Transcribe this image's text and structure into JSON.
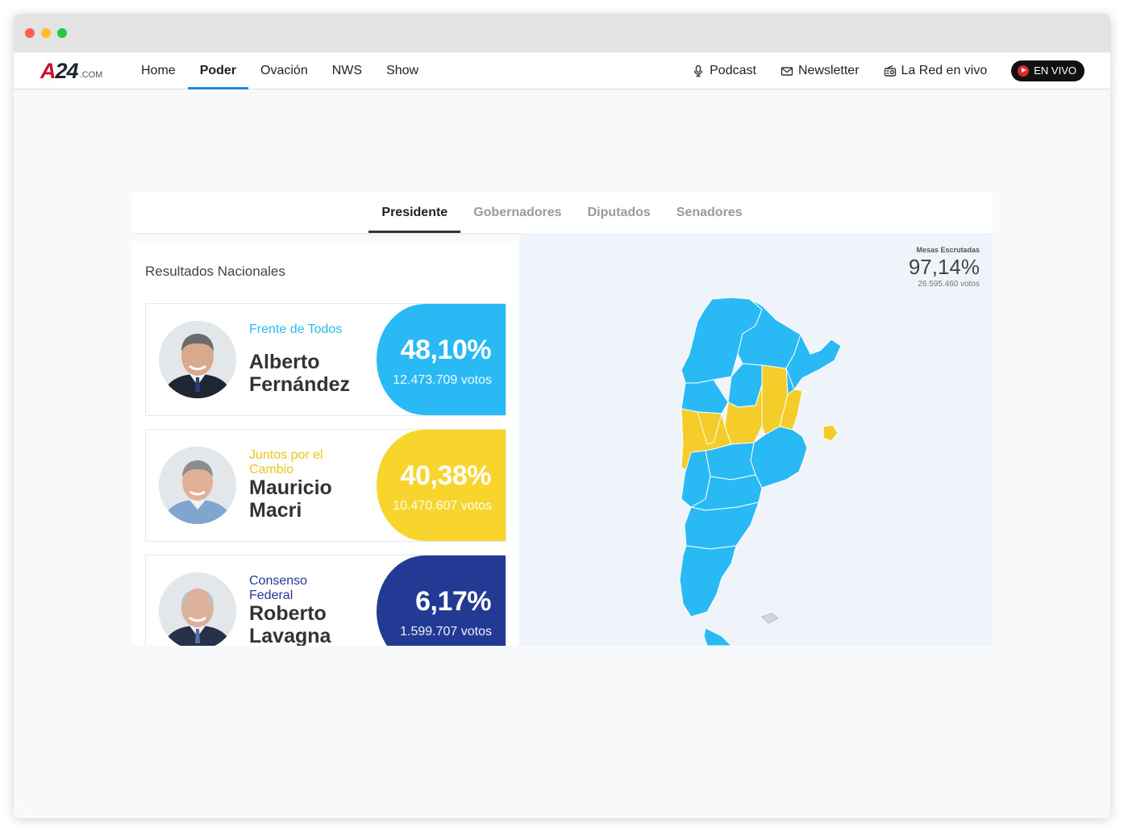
{
  "browser": {
    "dots": [
      "#ff5f57",
      "#febc2e",
      "#28c840"
    ]
  },
  "nav": {
    "logo_main": "A24",
    "logo_suffix": ".COM",
    "links": [
      "Home",
      "Poder",
      "Ovación",
      "NWS",
      "Show"
    ],
    "active_link": "Poder",
    "right_items": [
      {
        "label": "Podcast",
        "icon": "microphone-icon"
      },
      {
        "label": "Newsletter",
        "icon": "envelope-icon"
      },
      {
        "label": "La Red en vivo",
        "icon": "radio-icon"
      }
    ],
    "live_label": "EN VIVO"
  },
  "tabs": [
    "Presidente",
    "Gobernadores",
    "Diputados",
    "Senadores"
  ],
  "active_tab": "Presidente",
  "results": {
    "title": "Resultados Nacionales",
    "candidates": [
      {
        "party": "Frente de Todos",
        "name": "Alberto Fernández",
        "pct": "48,10%",
        "votes": "12.473.709 votos",
        "color": "#29baf6",
        "party_color": "#29baf6"
      },
      {
        "party": "Juntos por el Cambio",
        "name": "Mauricio Macri",
        "pct": "40,38%",
        "votes": "10.470.607 votos",
        "color": "#f7d52c",
        "party_color": "#f0c419"
      },
      {
        "party": "Consenso Federal",
        "name": "Roberto Lavagna",
        "pct": "6,17%",
        "votes": "1.599.707 votos",
        "color": "#233a95",
        "party_color": "#233a95"
      }
    ]
  },
  "scrutiny": {
    "label": "Mesas Escrutadas",
    "pct": "97,14%",
    "votes": "26.595.460 votos"
  },
  "map": {
    "blue": "#29baf6",
    "yellow": "#f4cd2a",
    "border": "#ffffff"
  }
}
